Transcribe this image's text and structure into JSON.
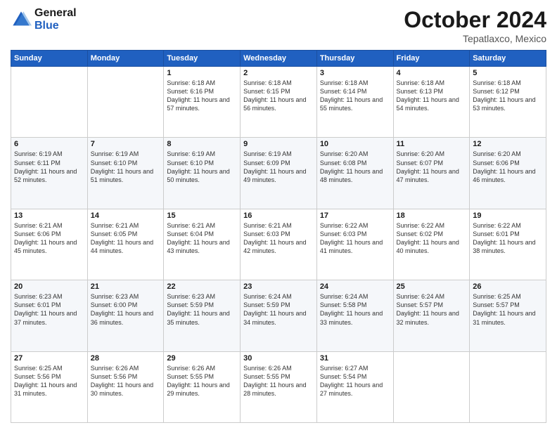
{
  "header": {
    "logo_line1": "General",
    "logo_line2": "Blue",
    "month": "October 2024",
    "location": "Tepatlaxco, Mexico"
  },
  "days_of_week": [
    "Sunday",
    "Monday",
    "Tuesday",
    "Wednesday",
    "Thursday",
    "Friday",
    "Saturday"
  ],
  "weeks": [
    [
      {
        "day": "",
        "sunrise": "",
        "sunset": "",
        "daylight": ""
      },
      {
        "day": "",
        "sunrise": "",
        "sunset": "",
        "daylight": ""
      },
      {
        "day": "1",
        "sunrise": "Sunrise: 6:18 AM",
        "sunset": "Sunset: 6:16 PM",
        "daylight": "Daylight: 11 hours and 57 minutes."
      },
      {
        "day": "2",
        "sunrise": "Sunrise: 6:18 AM",
        "sunset": "Sunset: 6:15 PM",
        "daylight": "Daylight: 11 hours and 56 minutes."
      },
      {
        "day": "3",
        "sunrise": "Sunrise: 6:18 AM",
        "sunset": "Sunset: 6:14 PM",
        "daylight": "Daylight: 11 hours and 55 minutes."
      },
      {
        "day": "4",
        "sunrise": "Sunrise: 6:18 AM",
        "sunset": "Sunset: 6:13 PM",
        "daylight": "Daylight: 11 hours and 54 minutes."
      },
      {
        "day": "5",
        "sunrise": "Sunrise: 6:18 AM",
        "sunset": "Sunset: 6:12 PM",
        "daylight": "Daylight: 11 hours and 53 minutes."
      }
    ],
    [
      {
        "day": "6",
        "sunrise": "Sunrise: 6:19 AM",
        "sunset": "Sunset: 6:11 PM",
        "daylight": "Daylight: 11 hours and 52 minutes."
      },
      {
        "day": "7",
        "sunrise": "Sunrise: 6:19 AM",
        "sunset": "Sunset: 6:10 PM",
        "daylight": "Daylight: 11 hours and 51 minutes."
      },
      {
        "day": "8",
        "sunrise": "Sunrise: 6:19 AM",
        "sunset": "Sunset: 6:10 PM",
        "daylight": "Daylight: 11 hours and 50 minutes."
      },
      {
        "day": "9",
        "sunrise": "Sunrise: 6:19 AM",
        "sunset": "Sunset: 6:09 PM",
        "daylight": "Daylight: 11 hours and 49 minutes."
      },
      {
        "day": "10",
        "sunrise": "Sunrise: 6:20 AM",
        "sunset": "Sunset: 6:08 PM",
        "daylight": "Daylight: 11 hours and 48 minutes."
      },
      {
        "day": "11",
        "sunrise": "Sunrise: 6:20 AM",
        "sunset": "Sunset: 6:07 PM",
        "daylight": "Daylight: 11 hours and 47 minutes."
      },
      {
        "day": "12",
        "sunrise": "Sunrise: 6:20 AM",
        "sunset": "Sunset: 6:06 PM",
        "daylight": "Daylight: 11 hours and 46 minutes."
      }
    ],
    [
      {
        "day": "13",
        "sunrise": "Sunrise: 6:21 AM",
        "sunset": "Sunset: 6:06 PM",
        "daylight": "Daylight: 11 hours and 45 minutes."
      },
      {
        "day": "14",
        "sunrise": "Sunrise: 6:21 AM",
        "sunset": "Sunset: 6:05 PM",
        "daylight": "Daylight: 11 hours and 44 minutes."
      },
      {
        "day": "15",
        "sunrise": "Sunrise: 6:21 AM",
        "sunset": "Sunset: 6:04 PM",
        "daylight": "Daylight: 11 hours and 43 minutes."
      },
      {
        "day": "16",
        "sunrise": "Sunrise: 6:21 AM",
        "sunset": "Sunset: 6:03 PM",
        "daylight": "Daylight: 11 hours and 42 minutes."
      },
      {
        "day": "17",
        "sunrise": "Sunrise: 6:22 AM",
        "sunset": "Sunset: 6:03 PM",
        "daylight": "Daylight: 11 hours and 41 minutes."
      },
      {
        "day": "18",
        "sunrise": "Sunrise: 6:22 AM",
        "sunset": "Sunset: 6:02 PM",
        "daylight": "Daylight: 11 hours and 40 minutes."
      },
      {
        "day": "19",
        "sunrise": "Sunrise: 6:22 AM",
        "sunset": "Sunset: 6:01 PM",
        "daylight": "Daylight: 11 hours and 38 minutes."
      }
    ],
    [
      {
        "day": "20",
        "sunrise": "Sunrise: 6:23 AM",
        "sunset": "Sunset: 6:01 PM",
        "daylight": "Daylight: 11 hours and 37 minutes."
      },
      {
        "day": "21",
        "sunrise": "Sunrise: 6:23 AM",
        "sunset": "Sunset: 6:00 PM",
        "daylight": "Daylight: 11 hours and 36 minutes."
      },
      {
        "day": "22",
        "sunrise": "Sunrise: 6:23 AM",
        "sunset": "Sunset: 5:59 PM",
        "daylight": "Daylight: 11 hours and 35 minutes."
      },
      {
        "day": "23",
        "sunrise": "Sunrise: 6:24 AM",
        "sunset": "Sunset: 5:59 PM",
        "daylight": "Daylight: 11 hours and 34 minutes."
      },
      {
        "day": "24",
        "sunrise": "Sunrise: 6:24 AM",
        "sunset": "Sunset: 5:58 PM",
        "daylight": "Daylight: 11 hours and 33 minutes."
      },
      {
        "day": "25",
        "sunrise": "Sunrise: 6:24 AM",
        "sunset": "Sunset: 5:57 PM",
        "daylight": "Daylight: 11 hours and 32 minutes."
      },
      {
        "day": "26",
        "sunrise": "Sunrise: 6:25 AM",
        "sunset": "Sunset: 5:57 PM",
        "daylight": "Daylight: 11 hours and 31 minutes."
      }
    ],
    [
      {
        "day": "27",
        "sunrise": "Sunrise: 6:25 AM",
        "sunset": "Sunset: 5:56 PM",
        "daylight": "Daylight: 11 hours and 31 minutes."
      },
      {
        "day": "28",
        "sunrise": "Sunrise: 6:26 AM",
        "sunset": "Sunset: 5:56 PM",
        "daylight": "Daylight: 11 hours and 30 minutes."
      },
      {
        "day": "29",
        "sunrise": "Sunrise: 6:26 AM",
        "sunset": "Sunset: 5:55 PM",
        "daylight": "Daylight: 11 hours and 29 minutes."
      },
      {
        "day": "30",
        "sunrise": "Sunrise: 6:26 AM",
        "sunset": "Sunset: 5:55 PM",
        "daylight": "Daylight: 11 hours and 28 minutes."
      },
      {
        "day": "31",
        "sunrise": "Sunrise: 6:27 AM",
        "sunset": "Sunset: 5:54 PM",
        "daylight": "Daylight: 11 hours and 27 minutes."
      },
      {
        "day": "",
        "sunrise": "",
        "sunset": "",
        "daylight": ""
      },
      {
        "day": "",
        "sunrise": "",
        "sunset": "",
        "daylight": ""
      }
    ]
  ]
}
